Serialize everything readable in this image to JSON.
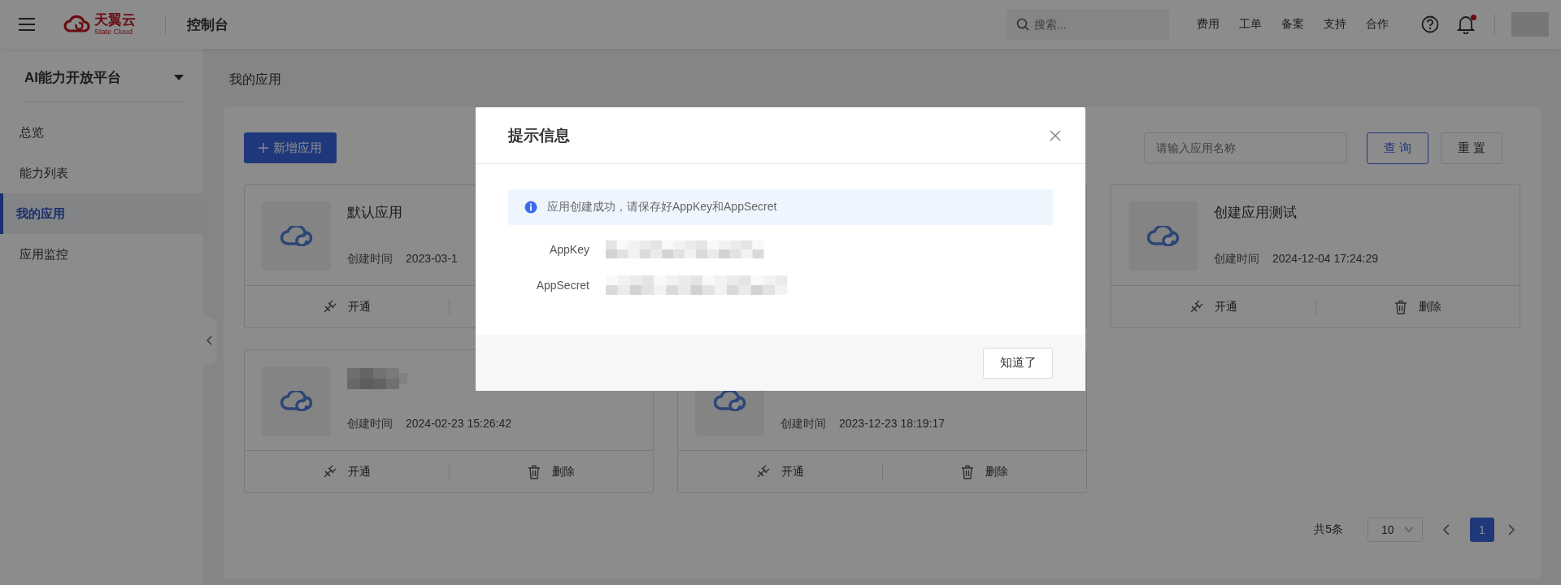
{
  "header": {
    "brand": "天翼云",
    "brand_sub": "State Cloud",
    "console": "控制台",
    "search": {
      "placeholder": "搜索..."
    },
    "links": [
      "费用",
      "工单",
      "备案",
      "支持",
      "合作"
    ],
    "notification_unread": true
  },
  "sidebar": {
    "title": "AI能力开放平台",
    "items": [
      {
        "label": "总览",
        "selected": false
      },
      {
        "label": "能力列表",
        "selected": false
      },
      {
        "label": "我的应用",
        "selected": true
      },
      {
        "label": "应用监控",
        "selected": false
      }
    ]
  },
  "breadcrumb": "我的应用",
  "toolbar": {
    "add_button": "新增应用",
    "search": {
      "placeholder": "请输入应用名称"
    },
    "query_button": "查 询",
    "reset_button": "重 置"
  },
  "cards": [
    {
      "kind": "app",
      "title": "默认应用",
      "title_redacted": false,
      "created_label": "创建时间",
      "created": "2023-03-1",
      "actions": [
        {
          "kind": "enable",
          "label": "开通"
        }
      ]
    },
    {
      "kind": "covered"
    },
    {
      "kind": "app",
      "title": "创建应用测试",
      "title_redacted": false,
      "created_label": "创建时间",
      "created": "2024-12-04 17:24:29",
      "actions": [
        {
          "kind": "enable",
          "label": "开通"
        },
        {
          "kind": "delete",
          "label": "删除"
        }
      ]
    },
    {
      "kind": "app",
      "title_redacted": true,
      "created_label": "创建时间",
      "created": "2024-02-23 15:26:42",
      "actions": [
        {
          "kind": "enable",
          "label": "开通"
        },
        {
          "kind": "delete",
          "label": "删除"
        }
      ]
    },
    {
      "kind": "app",
      "title_redacted": false,
      "created_label": "创建时间",
      "created": "2023-12-23 18:19:17",
      "actions": [
        {
          "kind": "enable",
          "label": "开通"
        },
        {
          "kind": "delete",
          "label": "删除"
        }
      ]
    }
  ],
  "pagination": {
    "total": "共5条",
    "page_size": "10",
    "pages": [
      {
        "label": "1",
        "selected": true
      }
    ]
  },
  "dialog": {
    "title": "提示信息",
    "alert": "应用创建成功，请保存好AppKey和AppSecret",
    "fields": [
      {
        "label": "AppKey"
      },
      {
        "label": "AppSecret"
      }
    ],
    "confirm_button": "知道了"
  }
}
